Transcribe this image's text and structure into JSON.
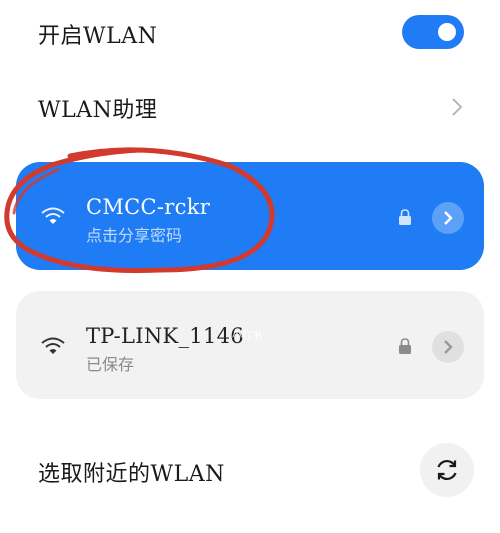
{
  "wlan": {
    "toggle_label": "开启WLAN",
    "toggle_on": true,
    "accent_color": "#1f7cf5"
  },
  "assistant": {
    "label": "WLAN助理",
    "icon": "chevron-right-icon"
  },
  "networks": [
    {
      "name": "CMCC-rckr",
      "subtitle": "点击分享密码",
      "connected": true,
      "secured": true,
      "icons": [
        "wifi-icon",
        "lock-icon",
        "chevron-right-icon"
      ]
    },
    {
      "name": "TP-LINK_1146",
      "subtitle": "已保存",
      "connected": false,
      "secured": true,
      "icons": [
        "wifi-icon",
        "lock-icon",
        "chevron-right-icon"
      ],
      "watermark": "小红书"
    }
  ],
  "nearby": {
    "label": "选取附近的WLAN",
    "icon": "refresh-icon"
  },
  "annotation": {
    "shape": "hand-drawn ellipse",
    "color": "#d23a2e"
  }
}
